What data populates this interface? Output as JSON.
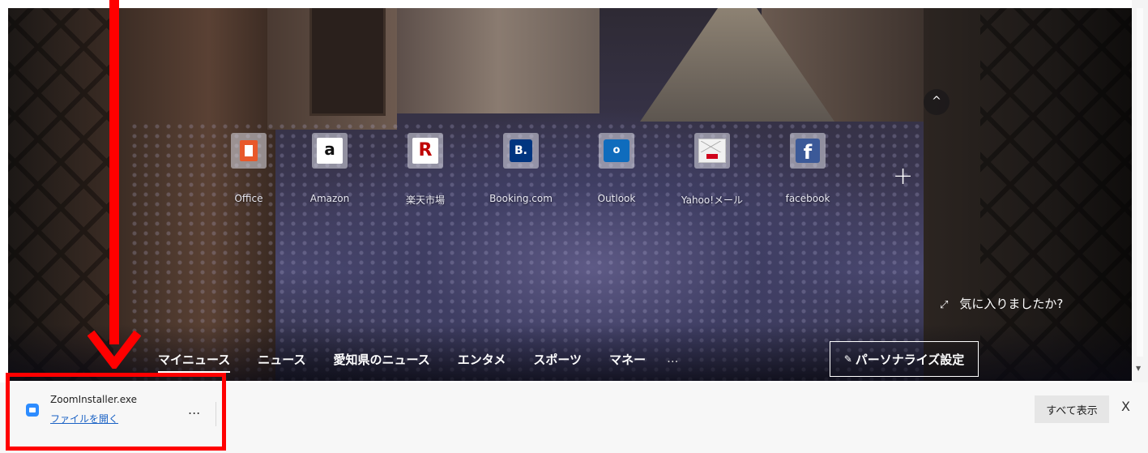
{
  "tiles": [
    {
      "label": "Office",
      "icon": "office-icon"
    },
    {
      "label": "Amazon",
      "icon": "amazon-icon",
      "glyph": "a"
    },
    {
      "label": "楽天市場",
      "icon": "rakuten-icon",
      "glyph": "R"
    },
    {
      "label": "Booking.com",
      "icon": "booking-icon",
      "glyph": "B."
    },
    {
      "label": "Outlook",
      "icon": "outlook-icon",
      "glyph": "o"
    },
    {
      "label": "Yahoo!メール",
      "icon": "yahoo-mail-icon"
    },
    {
      "label": "facebook",
      "icon": "facebook-icon",
      "glyph": "f"
    }
  ],
  "add_tile_glyph": "+",
  "collapse_glyph": "^",
  "like_prompt": {
    "text": "気に入りましたか?"
  },
  "news_tabs": [
    "マイニュース",
    "ニュース",
    "愛知県のニュース",
    "エンタメ",
    "スポーツ",
    "マネー"
  ],
  "news_more": "...",
  "personalize_label": "パーソナライズ設定",
  "download": {
    "file_name": "ZoomInstaller.exe",
    "open_link": "ファイルを開く",
    "more_glyph": "...",
    "show_all": "すべて表示",
    "close_glyph": "X"
  },
  "colors": {
    "annotation": "#ff0000",
    "link": "#1a62c5",
    "zoom": "#2d8cff"
  }
}
